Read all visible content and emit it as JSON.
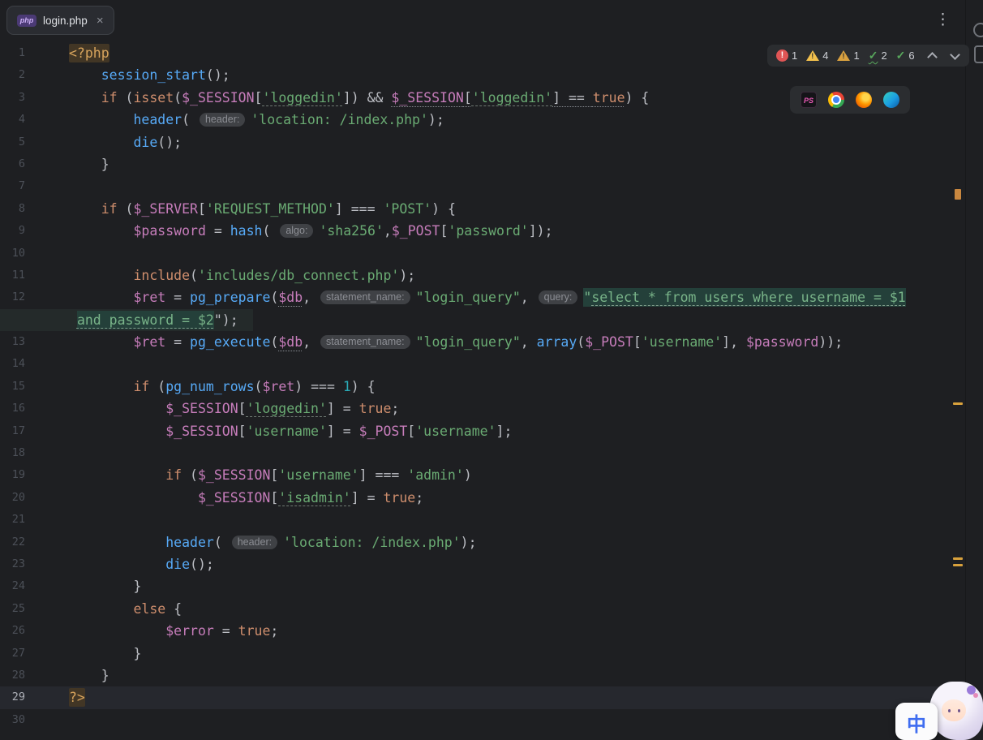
{
  "tab": {
    "title": "login.php",
    "icon_label": "php"
  },
  "icons": {
    "close_glyph": "×",
    "kebab_glyph": "⋮",
    "check_glyph": "✓",
    "builtin_preview_label": "PS"
  },
  "inspections": {
    "errors": "1",
    "warnings": "4",
    "weak_warnings": "1",
    "typos": "2",
    "passed": "6"
  },
  "ime": {
    "char": "中"
  },
  "colors": {
    "editor_bg": "#1e1f22",
    "keyword": "#cf8e6d",
    "function_call": "#57aaf7",
    "variable": "#c77dbb",
    "string": "#6aab73",
    "injected_sql_bg": "#24403a",
    "error_red": "#e05555",
    "warning_yellow": "#f2c04c"
  },
  "editor": {
    "lines": [
      {
        "num": "1",
        "tokens": [
          [
            "<?php",
            "tag"
          ]
        ]
      },
      {
        "num": "2",
        "tokens": [
          [
            "    ",
            "d"
          ],
          [
            "session_start",
            "fn"
          ],
          [
            "();",
            "d"
          ]
        ]
      },
      {
        "num": "3",
        "tokens": [
          [
            "    ",
            "d"
          ],
          [
            "if",
            "kw"
          ],
          [
            " (",
            "d"
          ],
          [
            "isset",
            "kw"
          ],
          [
            "(",
            "d"
          ],
          [
            "$_SESSION",
            "var"
          ],
          [
            "[",
            "d"
          ],
          [
            "'loggedin'",
            "strU"
          ],
          [
            "]",
            "d"
          ],
          [
            ") ",
            "d"
          ],
          [
            "&& ",
            "d"
          ],
          [
            "$_SESSION",
            "var",
            "u"
          ],
          [
            "[",
            "d",
            "u"
          ],
          [
            "'loggedin'",
            "strU",
            "u"
          ],
          [
            "]",
            "d",
            "u"
          ],
          [
            " == ",
            "d",
            "u"
          ],
          [
            "true",
            "kw",
            "u"
          ],
          [
            ") {",
            "d"
          ]
        ]
      },
      {
        "num": "4",
        "tokens": [
          [
            "        ",
            "d"
          ],
          [
            "header",
            "fn"
          ],
          [
            "( ",
            "d"
          ],
          [
            "header:",
            "pill"
          ],
          [
            "'location: /index.php'",
            "str"
          ],
          [
            ");",
            "d"
          ]
        ]
      },
      {
        "num": "5",
        "tokens": [
          [
            "        ",
            "d"
          ],
          [
            "die",
            "fn"
          ],
          [
            "();",
            "d"
          ]
        ]
      },
      {
        "num": "6",
        "tokens": [
          [
            "    }",
            "d"
          ]
        ]
      },
      {
        "num": "7",
        "tokens": []
      },
      {
        "num": "8",
        "tokens": [
          [
            "    ",
            "d"
          ],
          [
            "if",
            "kw"
          ],
          [
            " (",
            "d"
          ],
          [
            "$_SERVER",
            "var"
          ],
          [
            "[",
            "d"
          ],
          [
            "'REQUEST_METHOD'",
            "str"
          ],
          [
            "]",
            "d"
          ],
          [
            " === ",
            "d"
          ],
          [
            "'POST'",
            "str"
          ],
          [
            ") {",
            "d"
          ]
        ]
      },
      {
        "num": "9",
        "tokens": [
          [
            "        ",
            "d"
          ],
          [
            "$password",
            "var"
          ],
          [
            " = ",
            "d"
          ],
          [
            "hash",
            "fn"
          ],
          [
            "( ",
            "d"
          ],
          [
            "algo:",
            "pill"
          ],
          [
            "'sha256'",
            "str"
          ],
          [
            ",",
            "d"
          ],
          [
            "$_POST",
            "var"
          ],
          [
            "[",
            "d"
          ],
          [
            "'password'",
            "str"
          ],
          [
            "]);",
            "d"
          ]
        ]
      },
      {
        "num": "10",
        "tokens": []
      },
      {
        "num": "11",
        "tokens": [
          [
            "        ",
            "d"
          ],
          [
            "include",
            "kw"
          ],
          [
            "(",
            "d"
          ],
          [
            "'includes/db_connect.php'",
            "str"
          ],
          [
            ");",
            "d"
          ]
        ]
      },
      {
        "num": "12",
        "tokens": [
          [
            "        ",
            "d"
          ],
          [
            "$ret",
            "var"
          ],
          [
            " = ",
            "d"
          ],
          [
            "pg_prepare",
            "fn"
          ],
          [
            "(",
            "d"
          ],
          [
            "$db",
            "var",
            "u"
          ],
          [
            ", ",
            "d"
          ],
          [
            "statement_name:",
            "pill"
          ],
          [
            "\"login_query\"",
            "str"
          ],
          [
            ", ",
            "d"
          ],
          [
            "query:",
            "pill"
          ],
          [
            "\"",
            "inj"
          ],
          [
            "select * from users where username = $1",
            "injU"
          ]
        ]
      },
      {
        "num": "",
        "band": true,
        "tokens": [
          [
            " ",
            "d"
          ],
          [
            "and password = $2",
            "injU"
          ],
          [
            "\");",
            "d"
          ]
        ]
      },
      {
        "num": "13",
        "tokens": [
          [
            "        ",
            "d"
          ],
          [
            "$ret",
            "var"
          ],
          [
            " = ",
            "d"
          ],
          [
            "pg_execute",
            "fn"
          ],
          [
            "(",
            "d"
          ],
          [
            "$db",
            "var",
            "u"
          ],
          [
            ", ",
            "d"
          ],
          [
            "statement_name:",
            "pill"
          ],
          [
            "\"login_query\"",
            "str"
          ],
          [
            ", ",
            "d"
          ],
          [
            "array",
            "fn"
          ],
          [
            "(",
            "d"
          ],
          [
            "$_POST",
            "var"
          ],
          [
            "[",
            "d"
          ],
          [
            "'username'",
            "str"
          ],
          [
            "]",
            "d"
          ],
          [
            ", ",
            "d"
          ],
          [
            "$password",
            "var"
          ],
          [
            "));",
            "d"
          ]
        ]
      },
      {
        "num": "14",
        "tokens": []
      },
      {
        "num": "15",
        "tokens": [
          [
            "        ",
            "d"
          ],
          [
            "if",
            "kw"
          ],
          [
            " (",
            "d"
          ],
          [
            "pg_num_rows",
            "fn"
          ],
          [
            "(",
            "d"
          ],
          [
            "$ret",
            "var"
          ],
          [
            ")",
            "d"
          ],
          [
            " === ",
            "d"
          ],
          [
            "1",
            "num"
          ],
          [
            ") {",
            "d"
          ]
        ]
      },
      {
        "num": "16",
        "tokens": [
          [
            "            ",
            "d"
          ],
          [
            "$_SESSION",
            "var"
          ],
          [
            "[",
            "d"
          ],
          [
            "'loggedin'",
            "strU"
          ],
          [
            "]",
            "d"
          ],
          [
            " = ",
            "d"
          ],
          [
            "true",
            "kw"
          ],
          [
            ";",
            "d"
          ]
        ]
      },
      {
        "num": "17",
        "tokens": [
          [
            "            ",
            "d"
          ],
          [
            "$_SESSION",
            "var"
          ],
          [
            "[",
            "d"
          ],
          [
            "'username'",
            "str"
          ],
          [
            "]",
            "d"
          ],
          [
            " = ",
            "d"
          ],
          [
            "$_POST",
            "var"
          ],
          [
            "[",
            "d"
          ],
          [
            "'username'",
            "str"
          ],
          [
            "];",
            "d"
          ]
        ]
      },
      {
        "num": "18",
        "tokens": []
      },
      {
        "num": "19",
        "tokens": [
          [
            "            ",
            "d"
          ],
          [
            "if",
            "kw"
          ],
          [
            " (",
            "d"
          ],
          [
            "$_SESSION",
            "var"
          ],
          [
            "[",
            "d"
          ],
          [
            "'username'",
            "str"
          ],
          [
            "]",
            "d"
          ],
          [
            " === ",
            "d"
          ],
          [
            "'admin'",
            "str"
          ],
          [
            ")",
            "d"
          ]
        ]
      },
      {
        "num": "20",
        "tokens": [
          [
            "                ",
            "d"
          ],
          [
            "$_SESSION",
            "var"
          ],
          [
            "[",
            "d"
          ],
          [
            "'isadmin'",
            "strU"
          ],
          [
            "]",
            "d"
          ],
          [
            " = ",
            "d"
          ],
          [
            "true",
            "kw"
          ],
          [
            ";",
            "d"
          ]
        ]
      },
      {
        "num": "21",
        "tokens": []
      },
      {
        "num": "22",
        "tokens": [
          [
            "            ",
            "d"
          ],
          [
            "header",
            "fn"
          ],
          [
            "( ",
            "d"
          ],
          [
            "header:",
            "pill"
          ],
          [
            "'location: /index.php'",
            "str"
          ],
          [
            ");",
            "d"
          ]
        ]
      },
      {
        "num": "23",
        "tokens": [
          [
            "            ",
            "d"
          ],
          [
            "die",
            "fn"
          ],
          [
            "();",
            "d"
          ]
        ]
      },
      {
        "num": "24",
        "tokens": [
          [
            "        }",
            "d"
          ]
        ]
      },
      {
        "num": "25",
        "tokens": [
          [
            "        ",
            "d"
          ],
          [
            "else",
            "kw"
          ],
          [
            " {",
            "d"
          ]
        ]
      },
      {
        "num": "26",
        "tokens": [
          [
            "            ",
            "d"
          ],
          [
            "$error",
            "var"
          ],
          [
            " = ",
            "d"
          ],
          [
            "true",
            "kw"
          ],
          [
            ";",
            "d"
          ]
        ]
      },
      {
        "num": "27",
        "tokens": [
          [
            "        }",
            "d"
          ]
        ]
      },
      {
        "num": "28",
        "tokens": [
          [
            "    }",
            "d"
          ]
        ]
      },
      {
        "num": "29",
        "caret": true,
        "tokens": [
          [
            "?>",
            "tag"
          ]
        ]
      },
      {
        "num": "30",
        "tokens": []
      }
    ]
  }
}
